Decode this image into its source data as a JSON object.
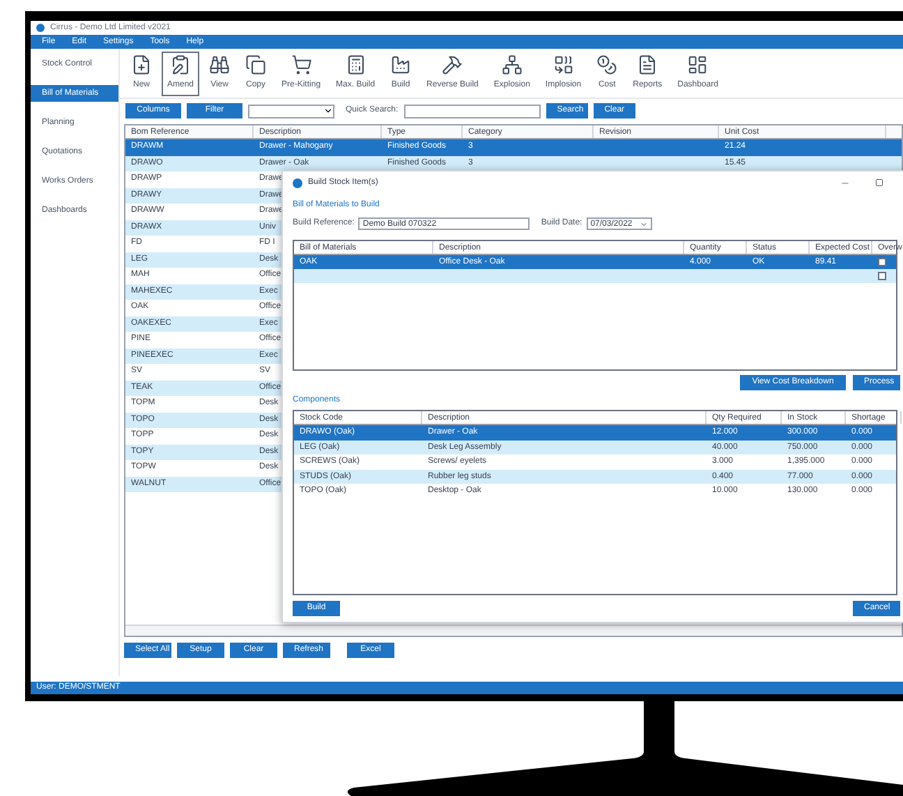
{
  "window": {
    "title": "Cirrus - Demo Ltd Limited v2021"
  },
  "menu": [
    "File",
    "Edit",
    "Settings",
    "Tools",
    "Help"
  ],
  "sidebar": {
    "items": [
      {
        "label": "Stock Control",
        "selected": false
      },
      {
        "label": "Bill of Materials",
        "selected": true
      },
      {
        "label": "Planning",
        "selected": false
      },
      {
        "label": "Quotations",
        "selected": false
      },
      {
        "label": "Works Orders",
        "selected": false
      },
      {
        "label": "Dashboards",
        "selected": false
      }
    ]
  },
  "toolbar": [
    {
      "label": "New",
      "selected": false
    },
    {
      "label": "Amend",
      "selected": true
    },
    {
      "label": "View",
      "selected": false
    },
    {
      "label": "Copy",
      "selected": false
    },
    {
      "label": "Pre-Kitting",
      "selected": false
    },
    {
      "label": "Max. Build",
      "selected": false
    },
    {
      "label": "Build",
      "selected": false
    },
    {
      "label": "Reverse Build",
      "selected": false
    },
    {
      "label": "Explosion",
      "selected": false
    },
    {
      "label": "Implosion",
      "selected": false
    },
    {
      "label": "Cost",
      "selected": false
    },
    {
      "label": "Reports",
      "selected": false
    },
    {
      "label": "Dashboard",
      "selected": false
    }
  ],
  "filter_bar": {
    "columns_button": "Columns",
    "filter_button": "Filter",
    "quick_search_label": "Quick Search:",
    "search_button": "Search",
    "clear_button": "Clear"
  },
  "table": {
    "columns": [
      "Bom Reference",
      "Description",
      "Type",
      "Category",
      "Revision",
      "Unit Cost"
    ],
    "rows": [
      {
        "cells": [
          "DRAWM",
          "Drawer - Mahogany",
          "Finished Goods",
          "3",
          "",
          "21.24"
        ],
        "selected": true
      },
      {
        "cells": [
          "DRAWO",
          "Drawer - Oak",
          "Finished Goods",
          "3",
          "",
          "15.45"
        ],
        "selected": false
      },
      {
        "cells": [
          "DRAWP",
          "Drawe"
        ],
        "selected": false
      },
      {
        "cells": [
          "DRAWY",
          "Drawe"
        ],
        "selected": false
      },
      {
        "cells": [
          "DRAWW",
          "Drawe"
        ],
        "selected": false
      },
      {
        "cells": [
          "DRAWX",
          "Univ"
        ],
        "selected": false
      },
      {
        "cells": [
          "FD",
          "FD I"
        ],
        "selected": false
      },
      {
        "cells": [
          "LEG",
          "Desk"
        ],
        "selected": false
      },
      {
        "cells": [
          "MAH",
          "Office"
        ],
        "selected": false
      },
      {
        "cells": [
          "MAHEXEC",
          "Exec"
        ],
        "selected": false
      },
      {
        "cells": [
          "OAK",
          "Office"
        ],
        "selected": false
      },
      {
        "cells": [
          "OAKEXEC",
          "Exec"
        ],
        "selected": false
      },
      {
        "cells": [
          "PINE",
          "Office"
        ],
        "selected": false
      },
      {
        "cells": [
          "PINEEXEC",
          "Exec"
        ],
        "selected": false
      },
      {
        "cells": [
          "SV",
          "SV"
        ],
        "selected": false
      },
      {
        "cells": [
          "TEAK",
          "Office"
        ],
        "selected": false
      },
      {
        "cells": [
          "TOPM",
          "Desk"
        ],
        "selected": false
      },
      {
        "cells": [
          "TOPO",
          "Desk"
        ],
        "selected": false
      },
      {
        "cells": [
          "TOPP",
          "Desk"
        ],
        "selected": false
      },
      {
        "cells": [
          "TOPY",
          "Desk"
        ],
        "selected": false
      },
      {
        "cells": [
          "TOPW",
          "Desk"
        ],
        "selected": false
      },
      {
        "cells": [
          "WALNUT",
          "Office"
        ],
        "selected": false
      }
    ]
  },
  "bottom_buttons": [
    "Select All",
    "Setup",
    "Clear",
    "Refresh",
    "Excel"
  ],
  "status_bar": "User: DEMO/STMENT",
  "dialog": {
    "title": "Build Stock Item(s)",
    "section": "Bill of Materials to Build",
    "build_reference_label": "Build Reference:",
    "build_reference": "Demo Build 070322",
    "build_date_label": "Build Date:",
    "build_date": "07/03/2022",
    "bom_table": {
      "columns": [
        "Bill of Materials",
        "Description",
        "Quantity",
        "Status",
        "Expected Cost",
        "Overw"
      ],
      "rows": [
        {
          "cells": [
            "OAK",
            "Office Desk - Oak",
            "4.000",
            "OK",
            "89.41"
          ],
          "checked": false,
          "selected": true
        },
        {
          "cells": [
            "",
            "",
            "",
            "",
            ""
          ],
          "checked": false,
          "selected": false
        }
      ]
    },
    "view_cost_button": "View Cost Breakdown",
    "process_button": "Process",
    "components_label": "Components",
    "components_table": {
      "columns": [
        "Stock Code",
        "Description",
        "Qty Required",
        "In Stock",
        "Shortage"
      ],
      "rows": [
        {
          "cells": [
            "DRAWO (Oak)",
            "Drawer - Oak",
            "12.000",
            "300.000",
            "0.000"
          ],
          "selected": true
        },
        {
          "cells": [
            "LEG (Oak)",
            "Desk Leg Assembly",
            "40.000",
            "750.000",
            "0.000"
          ],
          "selected": false
        },
        {
          "cells": [
            "SCREWS (Oak)",
            "Screws/ eyelets",
            "3.000",
            "1,395.000",
            "0.000"
          ],
          "selected": false
        },
        {
          "cells": [
            "STUDS (Oak)",
            "Rubber leg studs",
            "0.400",
            "77.000",
            "0.000"
          ],
          "selected": false
        },
        {
          "cells": [
            "TOPO (Oak)",
            "Desktop - Oak",
            "10.000",
            "130.000",
            "0.000"
          ],
          "selected": false
        }
      ]
    },
    "build_button": "Build",
    "cancel_button": "Cancel"
  }
}
